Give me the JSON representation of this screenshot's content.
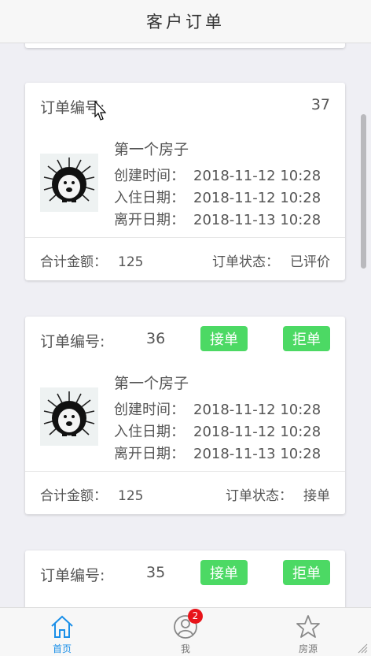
{
  "header": {
    "title": "客户订单"
  },
  "orders": [
    {
      "label": "订单编号:",
      "number": "37",
      "house": "第一个房子",
      "created_label": "创建时间：",
      "created": "2018-11-12 10:28",
      "checkin_label": "入住日期：",
      "checkin": "2018-11-12 10:28",
      "checkout_label": "离开日期：",
      "checkout": "2018-11-13 10:28",
      "total_label": "合计金额：",
      "total": "125",
      "status_label": "订单状态：",
      "status": "已评价"
    },
    {
      "label": "订单编号:",
      "number": "36",
      "accept": "接单",
      "reject": "拒单",
      "house": "第一个房子",
      "created_label": "创建时间：",
      "created": "2018-11-12 10:28",
      "checkin_label": "入住日期：",
      "checkin": "2018-11-12 10:28",
      "checkout_label": "离开日期：",
      "checkout": "2018-11-13 10:28",
      "total_label": "合计金额：",
      "total": "125",
      "status_label": "订单状态：",
      "status": "接单"
    },
    {
      "label": "订单编号:",
      "number": "35",
      "accept": "接单",
      "reject": "拒单"
    }
  ],
  "tabbar": {
    "home": "首页",
    "me": "我",
    "me_badge": "2",
    "houses": "房源",
    "active_color": "#1a8fe8"
  },
  "colors": {
    "accent_button": "#4cd964",
    "badge": "#e8141a"
  },
  "icons": [
    "home-icon",
    "user-icon",
    "star-icon",
    "hedgehog-thumbnail"
  ]
}
